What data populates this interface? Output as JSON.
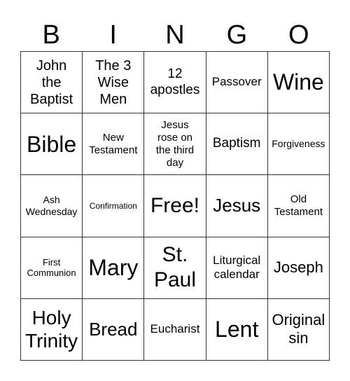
{
  "header": [
    "B",
    "I",
    "N",
    "G",
    "O"
  ],
  "cells": [
    "John the Baptist",
    "The 3 Wise Men",
    "12 apostles",
    "Passover",
    "Wine",
    "Bible",
    "New Testament",
    "Jesus rose on the third day",
    "Baptism",
    "Forgiveness",
    "Ash Wednesday",
    "Confirmation",
    "Free!",
    "Jesus",
    "Old Testament",
    "First Communion",
    "Mary",
    "St. Paul",
    "Liturgical calendar",
    "Joseph",
    "Holy Trinity",
    "Bread",
    "Eucharist",
    "Lent",
    "Original sin"
  ]
}
